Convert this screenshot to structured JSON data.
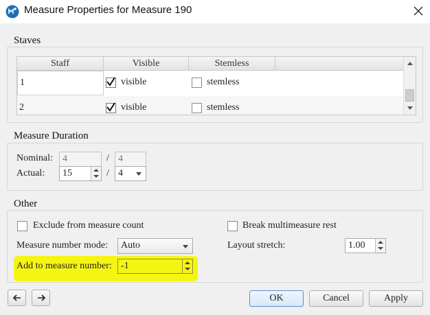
{
  "window": {
    "title": "Measure Properties for Measure 190"
  },
  "staves": {
    "label": "Staves",
    "columns": [
      "Staff",
      "Visible",
      "Stemless"
    ],
    "rows": [
      {
        "staff": "1",
        "visible_label": "visible",
        "visible_checked": true,
        "stemless_label": "stemless",
        "stemless_checked": false
      },
      {
        "staff": "2",
        "visible_label": "visible",
        "visible_checked": true,
        "stemless_label": "stemless",
        "stemless_checked": false
      }
    ]
  },
  "duration": {
    "label": "Measure Duration",
    "nominal_label": "Nominal:",
    "nominal_num": "4",
    "nominal_den": "4",
    "actual_label": "Actual:",
    "actual_num": "15",
    "actual_den": "4",
    "separator": "/"
  },
  "other": {
    "label": "Other",
    "exclude_label": "Exclude from measure count",
    "exclude_checked": false,
    "break_label": "Break multimeasure rest",
    "break_checked": false,
    "mode_label": "Measure number mode:",
    "mode_value": "Auto",
    "stretch_label": "Layout stretch:",
    "stretch_value": "1.00",
    "add_label": "Add to measure number:",
    "add_value": "-1",
    "highlight_color": "#f5f500"
  },
  "buttons": {
    "ok": "OK",
    "cancel": "Cancel",
    "apply": "Apply"
  },
  "icons": {
    "prev": "arrow-left-icon",
    "next": "arrow-right-icon",
    "app": "musescore-icon",
    "close": "close-icon"
  }
}
